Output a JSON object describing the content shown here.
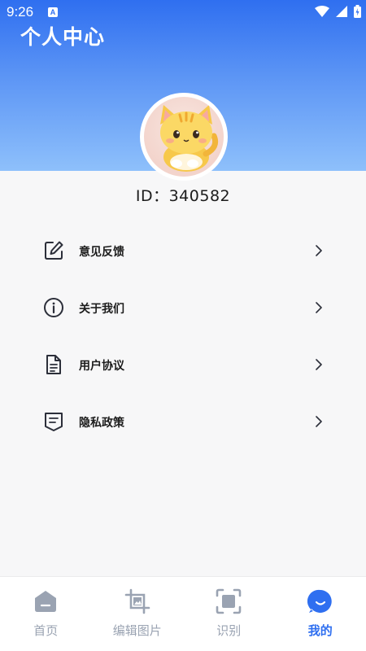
{
  "status_bar": {
    "time": "9:26",
    "app_badge": "A"
  },
  "header": {
    "title": "个人中心"
  },
  "profile": {
    "id_text": "ID：340582"
  },
  "menu": [
    {
      "label": "意见反馈",
      "icon": "edit-icon"
    },
    {
      "label": "关于我们",
      "icon": "info-icon"
    },
    {
      "label": "用户协议",
      "icon": "document-icon"
    },
    {
      "label": "隐私政策",
      "icon": "policy-icon"
    }
  ],
  "tabs": [
    {
      "label": "首页",
      "icon": "home-icon",
      "active": false
    },
    {
      "label": "编辑图片",
      "icon": "edit-image-icon",
      "active": false
    },
    {
      "label": "识别",
      "icon": "scan-icon",
      "active": false
    },
    {
      "label": "我的",
      "icon": "profile-icon",
      "active": true
    }
  ],
  "colors": {
    "accent": "#2f6ff0",
    "inactive": "#9aa3b2",
    "header_top": "#2f6ff0",
    "header_bottom": "#8ec0fb"
  }
}
